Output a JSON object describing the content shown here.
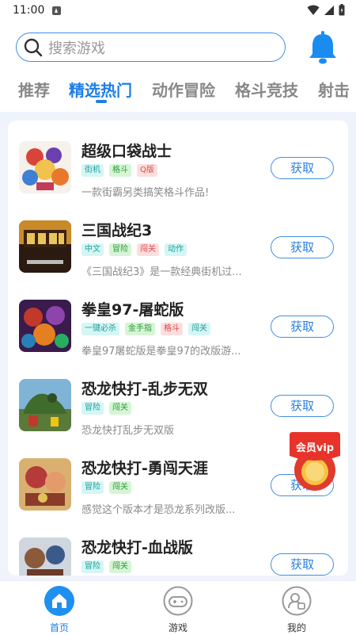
{
  "status": {
    "time": "11:00"
  },
  "search": {
    "placeholder": "搜索游戏"
  },
  "tabs": [
    {
      "label": "推荐"
    },
    {
      "label": "精选热门"
    },
    {
      "label": "动作冒险"
    },
    {
      "label": "格斗竞技"
    },
    {
      "label": "射击"
    }
  ],
  "games": [
    {
      "name": "超级口袋战士",
      "tags": [
        "街机",
        "格斗",
        "Q版"
      ],
      "desc": "一款街霸另类搞笑格斗作品!",
      "button": "获取"
    },
    {
      "name": "三国战纪3",
      "tags": [
        "中文",
        "冒险",
        "闯关",
        "动作"
      ],
      "desc": "《三国战纪3》是一款经典街机过...",
      "button": "获取"
    },
    {
      "name": "拳皇97-屠蛇版",
      "tags": [
        "一键必杀",
        "金手指",
        "格斗",
        "闯关"
      ],
      "desc": "拳皇97屠蛇版是拳皇97的改版游...",
      "button": "获取"
    },
    {
      "name": "恐龙快打-乱步无双",
      "tags": [
        "冒险",
        "闯关"
      ],
      "desc": "恐龙快打乱步无双版",
      "button": "获取"
    },
    {
      "name": "恐龙快打-勇闯天涯",
      "tags": [
        "冒险",
        "闯关"
      ],
      "desc": "感觉这个版本才是恐龙系列改版...",
      "button": "获取"
    },
    {
      "name": "恐龙快打-血战版",
      "tags": [
        "冒险",
        "闯关"
      ],
      "desc": "",
      "button": "获取"
    }
  ],
  "vip": {
    "label": "会员vip"
  },
  "nav": [
    {
      "label": "首页"
    },
    {
      "label": "游戏"
    },
    {
      "label": "我的"
    }
  ],
  "colors": {
    "accent": "#1e7ee8",
    "background": "#eff3fb"
  }
}
